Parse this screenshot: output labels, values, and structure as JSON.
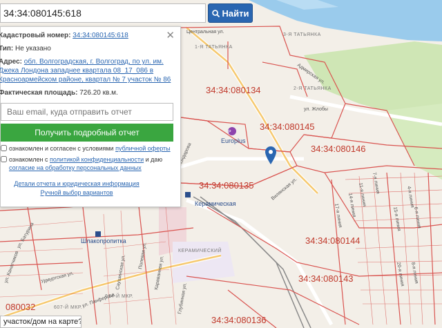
{
  "search": {
    "value": "34:34:080145:618",
    "button_label": "Найти"
  },
  "panel": {
    "cadastral_label": "Кадастровый номер:",
    "cadastral_value": "34:34:080145:618",
    "type_label": "Тип:",
    "type_value": "Не указано",
    "address_label": "Адрес:",
    "address_value": "обл. Волгоградская, г. Волгоград, по ул. им. Джека Лондона западнее квартала 08_17_086 в Красноармейском районе, квартал № 7 участок № 86",
    "area_label": "Фактическая площадь:",
    "area_value": "726.20 кв.м.",
    "email_placeholder": "Ваш email, куда отправить отчет",
    "report_button": "Получить подробный отчет",
    "check1_text": "ознакомлен и согласен с условиями",
    "check1_link": "публичной оферты",
    "check2_text": "ознакомлен с",
    "check2_link": "политикой конфиденциальности",
    "check2_mid": "и даю",
    "check2_link2": "согласие на обработку персональных данных",
    "link_details": "Детали отчета и юридическая информация",
    "link_manual": "Ручной выбор вариантов"
  },
  "bottom_chip": "участок/дом на карте?",
  "map": {
    "cadastral_blocks": [
      "34:34:080134",
      "34:34:080145",
      "34:34:080146",
      "34:34:080135",
      "34:34:080144",
      "34:34:080143",
      "34:34:080136",
      "080032"
    ],
    "pois": [
      "Europlus",
      "Керамическая",
      "Шлакопропитка"
    ],
    "streets": [
      "Центральная ул.",
      "Адмирская ул.",
      "ул. Жлобы",
      "Вилянская ул.",
      "Саушинская ул.",
      "Полевая ул.",
      "Караванная ул.",
      "Глубинная ул.",
      "Удмуртская ул.",
      "ул. Панферова",
      "ул. Батурина",
      "ул. Канатчиков",
      "Кондарова"
    ],
    "districts": [
      "3-Я ТАТЬЯНКА",
      "1-Я ТАТЬЯНКА",
      "2-Я ТАТЬЯНКА",
      "КЕРАМИЧЕСКИЙ",
      "614-Й МКР.",
      "607-Й МКР."
    ],
    "river": "Волга",
    "lines": [
      "4-я линия",
      "6-я линия",
      "8-я линия",
      "7-я линия",
      "14-я линия",
      "17-я линия",
      "11-я линия",
      "15-я линия",
      "20-я линия"
    ]
  },
  "colors": {
    "boundary": "#d9534f",
    "water": "#8fc4e8",
    "park": "#cfe8b8",
    "button_blue": "#2a66b1",
    "button_green": "#3aa640"
  }
}
